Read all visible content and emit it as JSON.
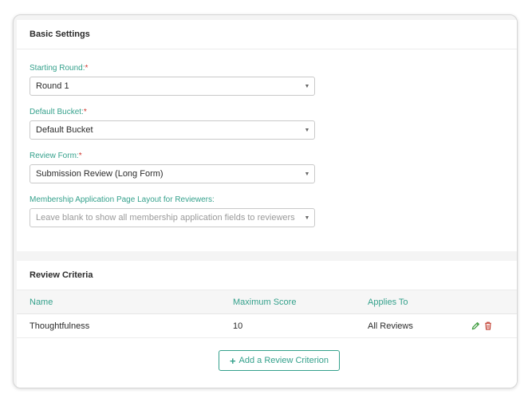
{
  "basic_settings": {
    "title": "Basic Settings",
    "starting_round": {
      "label": "Starting Round:",
      "required_mark": "*",
      "value": "Round 1"
    },
    "default_bucket": {
      "label": "Default Bucket:",
      "required_mark": "*",
      "value": "Default Bucket"
    },
    "review_form": {
      "label": "Review Form:",
      "required_mark": "*",
      "value": "Submission Review (Long Form)"
    },
    "page_layout": {
      "label": "Membership Application Page Layout for Reviewers:",
      "placeholder": "Leave blank to show all membership application fields to reviewers"
    }
  },
  "review_criteria": {
    "title": "Review Criteria",
    "columns": [
      "Name",
      "Maximum Score",
      "Applies To"
    ],
    "rows": [
      {
        "name": "Thoughtfulness",
        "max_score": "10",
        "applies_to": "All Reviews"
      }
    ],
    "add_button": {
      "icon": "plus-icon",
      "label": "Add a Review Criterion"
    }
  },
  "colors": {
    "accent": "#35a18c",
    "required": "#d0342c",
    "edit_icon": "#3c9a3c",
    "delete_icon": "#c0392b"
  }
}
